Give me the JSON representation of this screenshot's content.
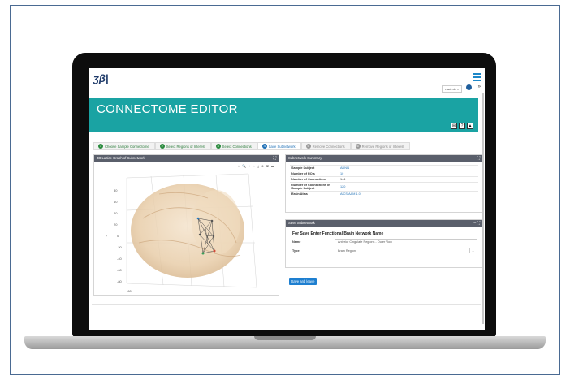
{
  "app": {
    "logo": "ʒβ|",
    "title": "CONNECTOME EDITOR",
    "user_menu": "▾ admin ▾",
    "header_buttons": [
      "⊞",
      "?",
      "▲"
    ]
  },
  "wizard": {
    "steps": [
      {
        "num": "1",
        "label": "Choose Sample Connectome",
        "state": "done"
      },
      {
        "num": "2",
        "label": "Select Regions of Interest",
        "state": "done"
      },
      {
        "num": "3",
        "label": "Select Connections",
        "state": "done"
      },
      {
        "num": "4",
        "label": "Save Subnetwork",
        "state": "active"
      },
      {
        "num": "5",
        "label": "Remove Connections",
        "state": "pending"
      },
      {
        "num": "6",
        "label": "Remove Regions of Interest",
        "state": "pending"
      }
    ]
  },
  "graph_panel": {
    "title": "3D Lattice Graph of Subnetwork",
    "tools": "⌂ 🔍 + ◌ ⤓ ⊙ ▣ ▬",
    "axis_ticks": [
      "80",
      "60",
      "40",
      "20",
      "0",
      "-20",
      "-40",
      "-60",
      "-80",
      "-60"
    ],
    "axis_label": "y"
  },
  "summary_panel": {
    "title": "Subnetwork Summary",
    "rows": [
      {
        "key": "Sample Subject",
        "value": "ADNI1",
        "style": "link"
      },
      {
        "key": "Number of ROIs",
        "value": "10",
        "style": "link"
      },
      {
        "key": "Number of Connections",
        "value": "144",
        "style": "plain"
      },
      {
        "key": "Number of Connections in Sample Subject",
        "value": "120",
        "style": "link"
      },
      {
        "key": "Brain Atlas",
        "value": "AICS-AAM 1.0",
        "style": "link"
      }
    ]
  },
  "save_panel": {
    "title": "Save Subnetwork",
    "heading": "For Save Enter Functional Brain Network Name",
    "name_label": "Name",
    "name_value": "Anterior Cingulate Regions - Outer Row",
    "type_label": "Type",
    "type_value": "Brain Region"
  },
  "actions": {
    "save_and_leave": "Save and leave"
  }
}
